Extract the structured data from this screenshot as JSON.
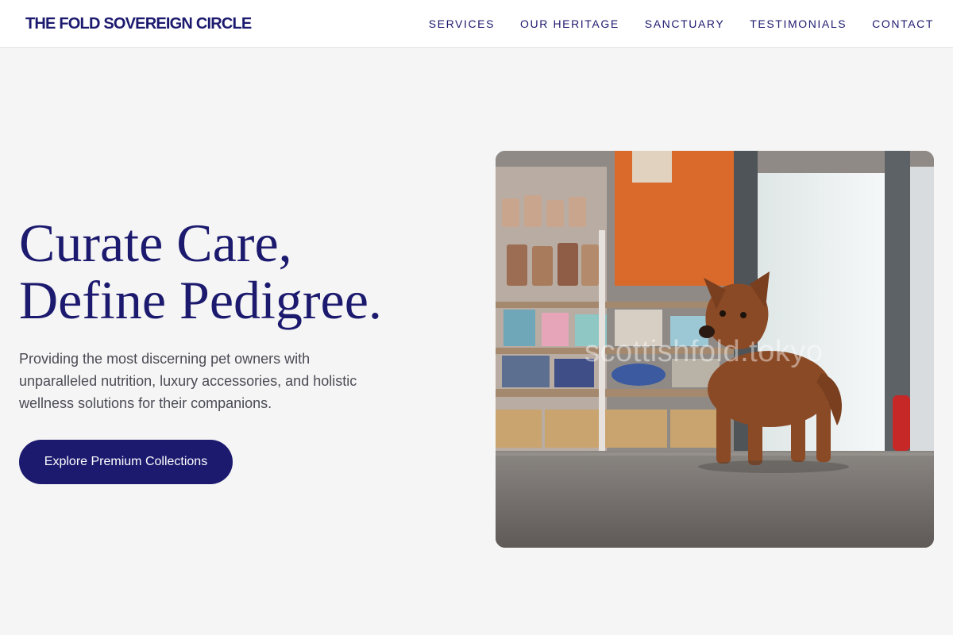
{
  "brand": {
    "name": "THE FOLD SOVEREIGN CIRCLE"
  },
  "nav": {
    "items": [
      {
        "label": "SERVICES"
      },
      {
        "label": "OUR HERITAGE"
      },
      {
        "label": "SANCTUARY"
      },
      {
        "label": "TESTIMONIALS"
      },
      {
        "label": "CONTACT"
      }
    ]
  },
  "hero": {
    "title_line1": "Curate Care,",
    "title_line2": "Define Pedigree.",
    "description": "Providing the most discerning pet owners with unparalleled nutrition, luxury accessories, and holistic wellness solutions for their companions.",
    "cta_label": "Explore Premium Collections",
    "image": {
      "watermark": "scottishfold.tokyo"
    }
  },
  "colors": {
    "primary": "#1c1a6e",
    "background": "#f5f5f5",
    "body_text": "#4b4b55"
  }
}
